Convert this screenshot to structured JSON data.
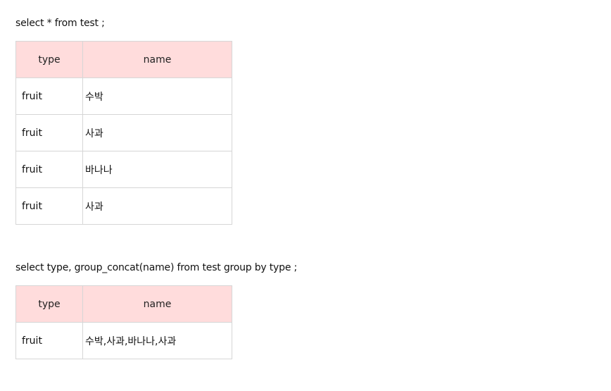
{
  "query1": {
    "sql": "select * from test ;",
    "columns": [
      "type",
      "name"
    ],
    "rows": [
      [
        "fruit",
        "수박"
      ],
      [
        "fruit",
        "사과"
      ],
      [
        "fruit",
        "바나나"
      ],
      [
        "fruit",
        "사과"
      ]
    ]
  },
  "query2": {
    "sql": "select type, group_concat(name) from test group by type ;",
    "columns": [
      "type",
      "name"
    ],
    "rows": [
      [
        "fruit",
        "수박,사과,바나나,사과"
      ]
    ]
  }
}
